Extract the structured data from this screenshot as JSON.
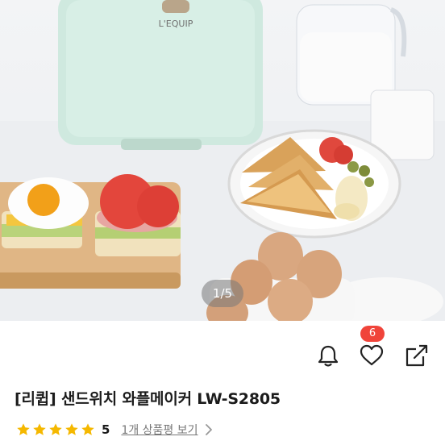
{
  "gallery": {
    "pager_text": "1/5",
    "appliance_brand": "L'EQUIP"
  },
  "actions": {
    "bell_icon": "bell-icon",
    "heart_icon": "heart-icon",
    "share_icon": "share-icon",
    "like_count": "6",
    "like_badge_color": "#f0443a"
  },
  "product": {
    "title": "[리큅] 샌드위치 와플메이커 LW-S2805"
  },
  "rating": {
    "stars": 5,
    "value": "5",
    "star_color": "#f5b800",
    "review_link": "1개 상품평 보기",
    "chevron_icon": "chevron-right-icon"
  }
}
